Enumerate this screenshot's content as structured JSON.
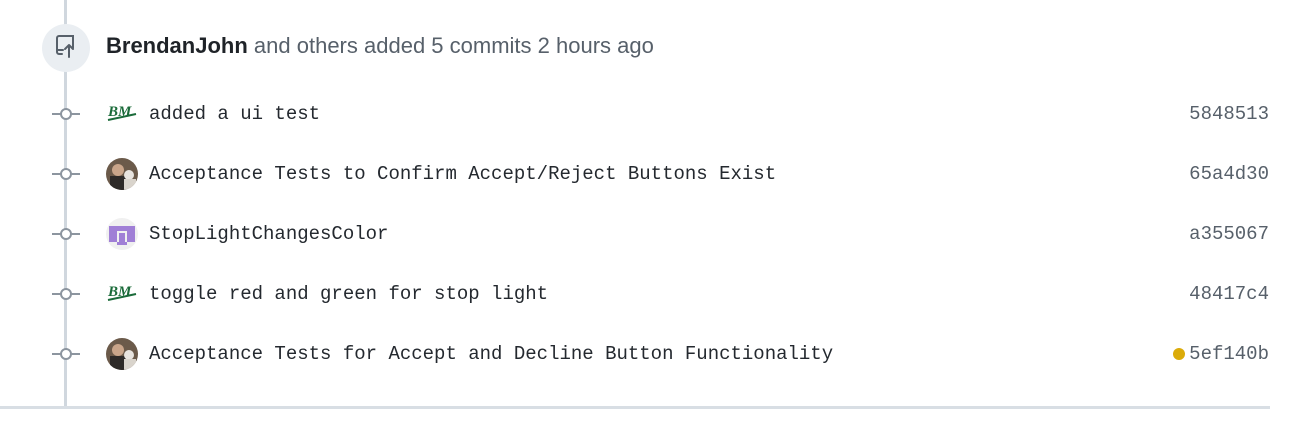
{
  "header": {
    "author": "BrendanJohn",
    "action": "and others added 5 commits",
    "time": "2 hours ago"
  },
  "commits": [
    {
      "message": "added a ui test",
      "sha": "5848513",
      "avatar": "bm-logo-avatar"
    },
    {
      "message": "Acceptance Tests to Confirm Accept/Reject Buttons Exist",
      "sha": "65a4d30",
      "avatar": "photo-avatar"
    },
    {
      "message": "StopLightChangesColor",
      "sha": "a355067",
      "avatar": "identicon-avatar"
    },
    {
      "message": "toggle red and green for stop light",
      "sha": "48417c4",
      "avatar": "bm-logo-avatar"
    },
    {
      "message": "Acceptance Tests for Accept and Decline Button Functionality",
      "sha": "5ef140b",
      "avatar": "photo-avatar",
      "status": "pending"
    }
  ],
  "colors": {
    "status_pending": "#dbab09",
    "timeline": "#d0d7de",
    "identicon": "#a07fd6"
  }
}
